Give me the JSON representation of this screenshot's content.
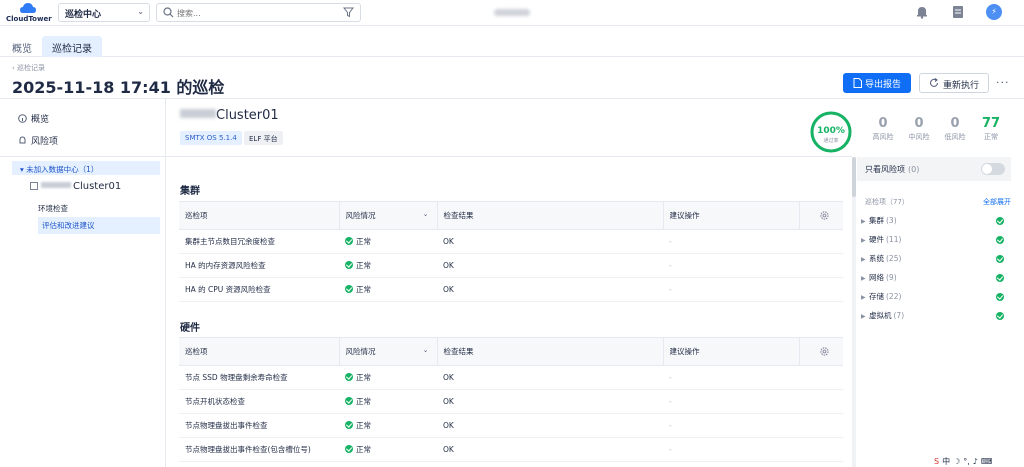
{
  "app": {
    "brand": "CloudTower",
    "context_select": "巡检中心"
  },
  "search": {
    "placeholder": "搜索..."
  },
  "tabs": [
    {
      "label": "概览"
    },
    {
      "label": "巡检记录"
    }
  ],
  "breadcrumb": "巡检记录",
  "page_title": "2025-11-18 17:41 的巡检",
  "actions": {
    "export": "导出报告",
    "rerun": "重新执行",
    "more": "···"
  },
  "left_nav": {
    "overview": "概览",
    "risks": "风险项",
    "group": "未加入数据中心（1）",
    "cluster": "Cluster01",
    "sub_items": [
      "环境检查",
      "评估和改进建议"
    ]
  },
  "cluster": {
    "name": "Cluster01",
    "os_tag": "SMTX OS  5.1.4",
    "platform_tag": "ELF 平台",
    "pass_rate": "100%",
    "pass_rate_label": "通过率",
    "pass_fraction": 1.0,
    "stats": [
      {
        "num": "0",
        "label": "高风险"
      },
      {
        "num": "0",
        "label": "中风险"
      },
      {
        "num": "0",
        "label": "低风险"
      },
      {
        "num": "77",
        "label": "正常"
      }
    ]
  },
  "table_headers": {
    "item": "巡检项",
    "risk": "风险情况",
    "result": "检查结果",
    "advice": "建议操作"
  },
  "sections": [
    {
      "title": "集群",
      "rows": [
        {
          "item": "集群主节点数目冗余度检查",
          "risk": "正常",
          "result": "OK",
          "advice": "-"
        },
        {
          "item": "HA 的内存资源风险检查",
          "risk": "正常",
          "result": "OK",
          "advice": "-"
        },
        {
          "item": "HA 的 CPU 资源风险检查",
          "risk": "正常",
          "result": "OK",
          "advice": "-"
        }
      ]
    },
    {
      "title": "硬件",
      "rows": [
        {
          "item": "节点 SSD 物理盘剩余寿命检查",
          "risk": "正常",
          "result": "OK",
          "advice": "-"
        },
        {
          "item": "节点开机状态检查",
          "risk": "正常",
          "result": "OK",
          "advice": "-"
        },
        {
          "item": "节点物理盘拔出事件检查",
          "risk": "正常",
          "result": "OK",
          "advice": "-"
        },
        {
          "item": "节点物理盘拔出事件检查(包含槽位号)",
          "risk": "正常",
          "result": "OK",
          "advice": "-"
        }
      ]
    }
  ],
  "right_panel": {
    "risk_only_label": "只看风险项",
    "risk_only_count": "(0)",
    "total_label": "巡检项（77）",
    "expand_all": "全部展开",
    "categories": [
      {
        "name": "集群",
        "count": "(3)"
      },
      {
        "name": "硬件",
        "count": "(11)"
      },
      {
        "name": "系统",
        "count": "(25)"
      },
      {
        "name": "网络",
        "count": "(9)"
      },
      {
        "name": "存储",
        "count": "(22)"
      },
      {
        "name": "虚拟机",
        "count": "(7)"
      }
    ]
  },
  "colors": {
    "primary": "#0f6ef5",
    "ok": "#16b364",
    "active_bg": "#e4f0ff"
  }
}
